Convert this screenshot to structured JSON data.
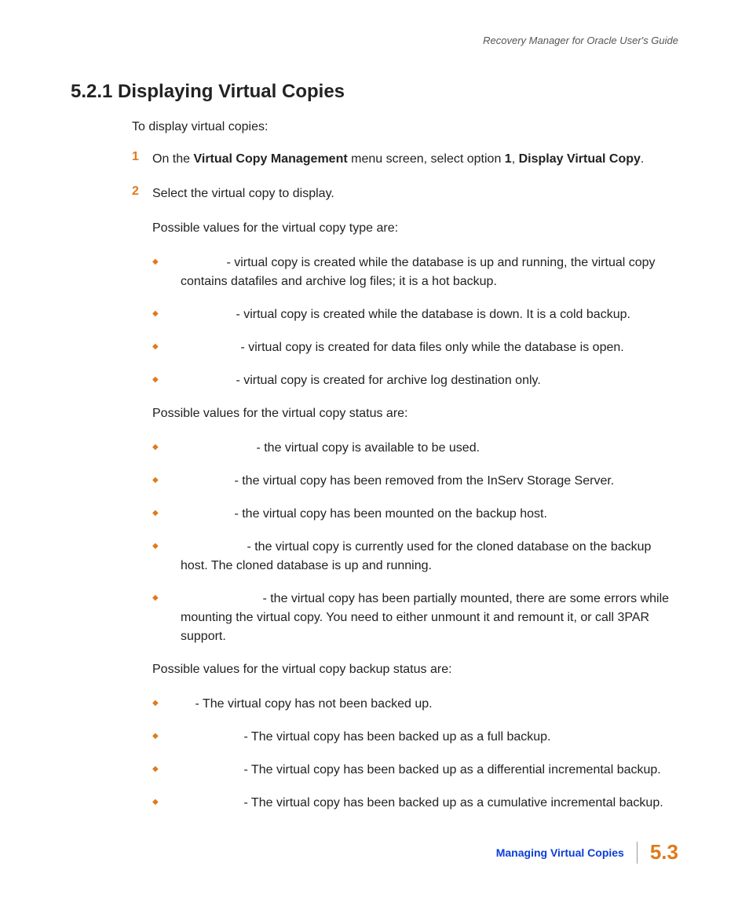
{
  "header": {
    "running_head": "Recovery Manager for Oracle User's Guide"
  },
  "heading": "5.2.1 Displaying Virtual Copies",
  "intro": "To display virtual copies:",
  "steps": [
    {
      "num": "1",
      "pre": "On the ",
      "bold1": "Virtual Copy Management",
      "mid": " menu screen, select option ",
      "bold2": "1",
      "mid2": ", ",
      "bold3": "Display Virtual Copy",
      "post": "."
    },
    {
      "num": "2",
      "text": "Select the virtual copy to display."
    }
  ],
  "type_intro": "Possible values for the virtual copy type are:",
  "type_bullets": [
    " - virtual copy is created while the database is up and running, the virtual copy contains datafiles and archive log files; it is a hot backup.",
    " - virtual copy is created while the database is down. It is a cold backup.",
    " - virtual copy is created for data files only while the database is open.",
    " - virtual copy is created for archive log destination only."
  ],
  "type_gaps": [
    54,
    66,
    72,
    66
  ],
  "status_intro": "Possible values for the virtual copy status are:",
  "status_bullets": [
    " - the virtual copy is available to be used.",
    " - the virtual copy has been removed from the InServ Storage Server.",
    " - the virtual copy has been mounted on the backup host.",
    " - the virtual copy is currently used for the cloned database on the backup host. The cloned database is up and running.",
    " - the virtual copy has been partially mounted, there are some errors while mounting the virtual copy. You need to either unmount it and remount it, or call 3PAR support."
  ],
  "status_gaps": [
    92,
    64,
    64,
    80,
    100
  ],
  "backup_intro": "Possible values for the virtual copy backup status are:",
  "backup_bullets": [
    " - The virtual copy has not been backed up.",
    " - The virtual copy has been backed up as a full backup.",
    " - The virtual copy has been backed up as a differential incremental backup.",
    " - The virtual copy has been backed up as a cumulative incremental backup."
  ],
  "backup_gaps": [
    14,
    76,
    76,
    76
  ],
  "footer": {
    "section": "Managing Virtual Copies",
    "page": "5.3"
  }
}
